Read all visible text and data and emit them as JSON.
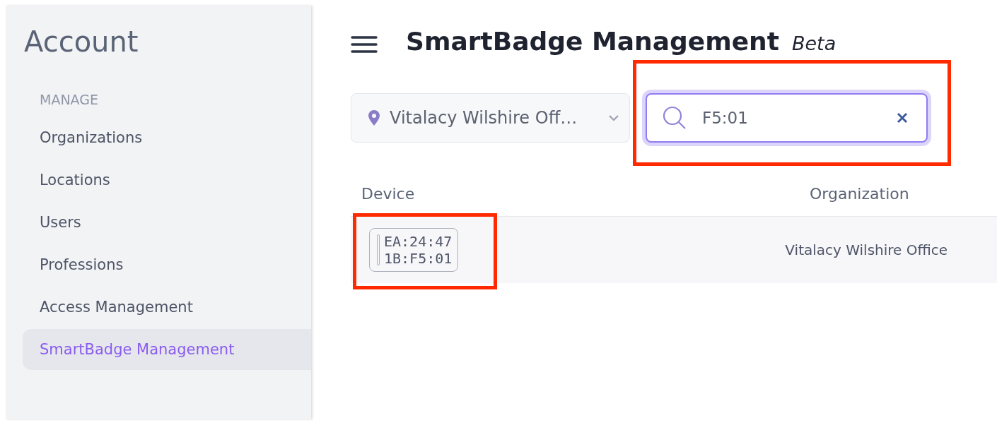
{
  "sidebar": {
    "title": "Account",
    "section": "MANAGE",
    "items": [
      {
        "label": "Organizations",
        "selected": false
      },
      {
        "label": "Locations",
        "selected": false
      },
      {
        "label": "Users",
        "selected": false
      },
      {
        "label": "Professions",
        "selected": false
      },
      {
        "label": "Access Management",
        "selected": false
      },
      {
        "label": "SmartBadge Management",
        "selected": true
      }
    ]
  },
  "header": {
    "title": "SmartBadge Management",
    "badge": "Beta"
  },
  "filters": {
    "location": "Vitalacy Wilshire Off…",
    "search": {
      "value": "F5:01",
      "highlighted": true
    }
  },
  "table": {
    "columns": [
      "Device",
      "Organization"
    ],
    "rows": [
      {
        "device": [
          "EA:24:47",
          "1B:F5:01"
        ],
        "organization": "Vitalacy Wilshire Office",
        "highlighted": true
      }
    ]
  }
}
